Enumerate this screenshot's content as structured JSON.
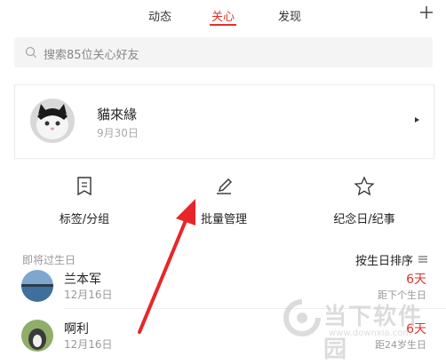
{
  "tabs": [
    {
      "label": "动态",
      "active": false
    },
    {
      "label": "关心",
      "active": true
    },
    {
      "label": "发现",
      "active": false
    }
  ],
  "accent_color": "#e0322b",
  "search": {
    "placeholder": "搜索85位关心好友"
  },
  "featured_friend": {
    "name": "貓來緣",
    "date": "9月30日",
    "avatar_icon": "cat-avatar"
  },
  "actions": [
    {
      "label": "标签/分组",
      "icon": "bookmark-icon"
    },
    {
      "label": "批量管理",
      "icon": "edit-icon"
    },
    {
      "label": "纪念日/纪事",
      "icon": "star-icon"
    }
  ],
  "birthday_section": {
    "title": "即将过生日",
    "sort_label": "按生日排序",
    "items": [
      {
        "name": "兰本军",
        "date": "12月16日",
        "days": "6天",
        "note": "距下个生日"
      },
      {
        "name": "啊利",
        "date": "12月16日",
        "days": "6天",
        "note": "距24岁生日"
      }
    ]
  },
  "watermark": {
    "title": "当下软件园",
    "url": "www.downxia.com"
  }
}
